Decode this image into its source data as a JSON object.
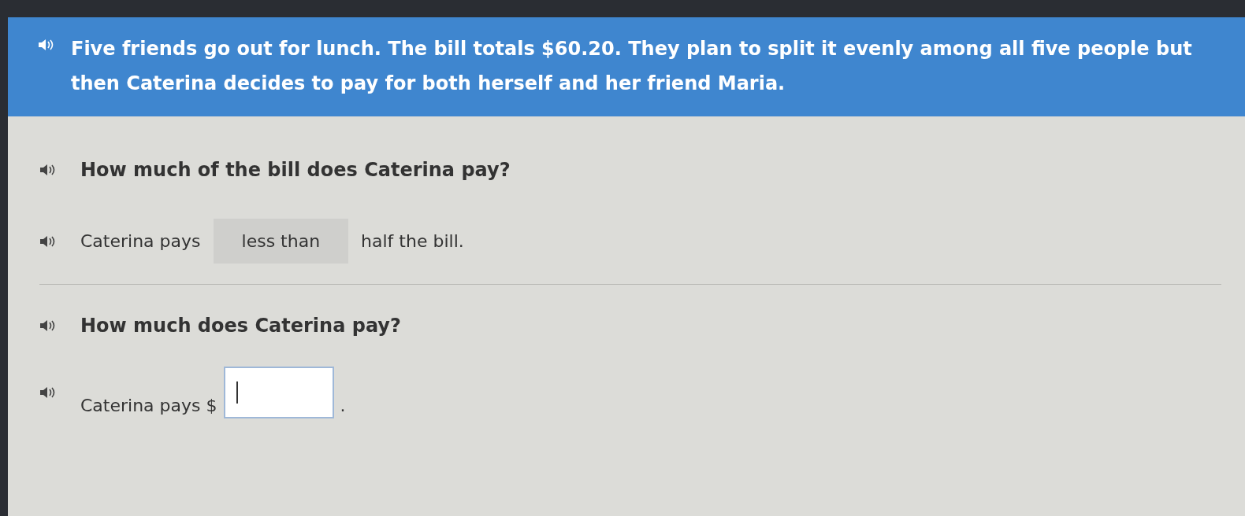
{
  "problem": {
    "text": "Five friends go out for lunch. The bill totals $60.20. They plan to split it evenly among all five people but then Caterina decides to pay for both herself and her friend Maria."
  },
  "part_a": {
    "question": "How much of the bill does Caterina pay?",
    "before": "Caterina pays",
    "dropdown_value": "less than",
    "after": "half the bill."
  },
  "part_b": {
    "question": "How much does Caterina pay?",
    "before": "Caterina pays $",
    "after": "."
  }
}
